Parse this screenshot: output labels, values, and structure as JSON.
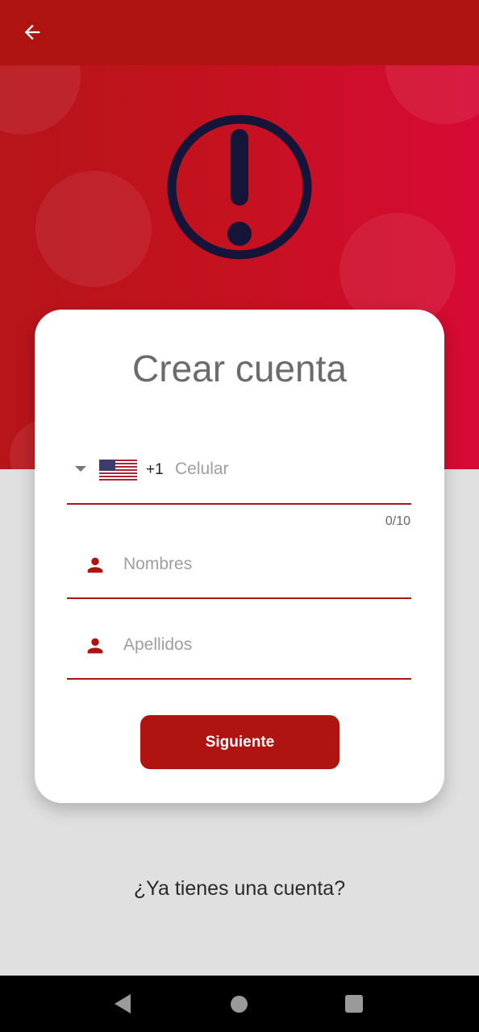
{
  "header": {
    "back_icon": "arrow-left-icon",
    "color": "#b01410"
  },
  "hero": {
    "alert_icon": "exclamation-circle-icon",
    "gradient_start": "#b7151a",
    "gradient_end": "#d70a35"
  },
  "card": {
    "title": "Crear cuenta",
    "phone": {
      "country_flag": "us-flag-icon",
      "dial_code": "+1",
      "placeholder": "Celular",
      "counter": "0/10"
    },
    "first_name": {
      "icon": "person-icon",
      "placeholder": "Nombres"
    },
    "last_name": {
      "icon": "person-icon",
      "placeholder": "Apellidos"
    },
    "next_label": "Siguiente"
  },
  "footer": {
    "login_prompt": "¿Ya tienes una cuenta?"
  },
  "system_nav": {
    "back": "nav-back-icon",
    "home": "nav-home-icon",
    "recents": "nav-recents-icon"
  },
  "colors": {
    "accent": "#b01410",
    "text_muted": "#9e9e9e",
    "background": "#e0e0e0"
  }
}
